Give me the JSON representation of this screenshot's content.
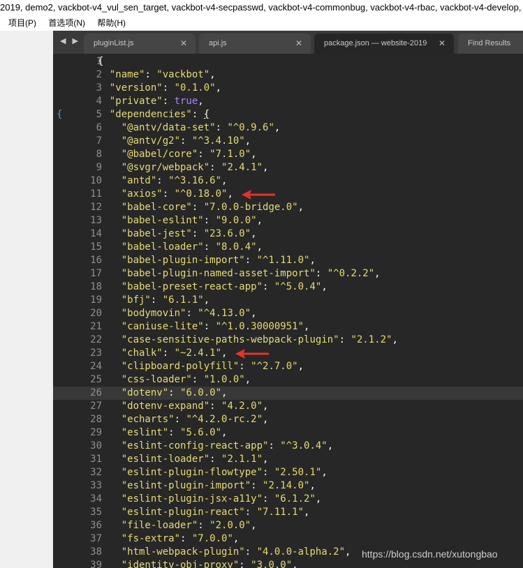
{
  "window": {
    "title": "2019, demo2, vackbot-v4_vul_sen_target, vackbot-v4-secpasswd, vackbot-v4-commonbug, vackbot-v4-rbac, vackbot-v4-develop,"
  },
  "menu": [
    "项目(P)",
    "首选项(N)",
    "帮助(H)"
  ],
  "tab_nav": "◀ ▶",
  "tabs": [
    {
      "label": "pluginList.js",
      "close": "✕"
    },
    {
      "label": "api.js",
      "close": "✕"
    },
    {
      "label": "package.json — website-2019",
      "close": "✕"
    },
    {
      "label": "Find Results",
      "close": ""
    }
  ],
  "highlight_line": 26,
  "fold_marker": "{",
  "code_lines": [
    {
      "n": "1",
      "p": [
        "{"
      ]
    },
    {
      "n": "2",
      "p": [
        "  ",
        "\"name\"",
        ": ",
        "\"vackbot\"",
        ","
      ]
    },
    {
      "n": "3",
      "p": [
        "  ",
        "\"version\"",
        ": ",
        "\"0.1.0\"",
        ","
      ]
    },
    {
      "n": "4",
      "p": [
        "  ",
        "\"private\"",
        ": ",
        "true",
        ","
      ]
    },
    {
      "n": "5",
      "p": [
        "  ",
        "\"dependencies\"",
        ": ",
        "{",
        ""
      ]
    },
    {
      "n": "6",
      "p": [
        "    ",
        "\"@antv/data-set\"",
        ": ",
        "\"^0.9.6\"",
        ","
      ]
    },
    {
      "n": "7",
      "p": [
        "    ",
        "\"@antv/g2\"",
        ": ",
        "\"^3.4.10\"",
        ","
      ]
    },
    {
      "n": "8",
      "p": [
        "    ",
        "\"@babel/core\"",
        ": ",
        "\"7.1.0\"",
        ","
      ]
    },
    {
      "n": "9",
      "p": [
        "    ",
        "\"@svgr/webpack\"",
        ": ",
        "\"2.4.1\"",
        ","
      ]
    },
    {
      "n": "10",
      "p": [
        "    ",
        "\"antd\"",
        ": ",
        "\"^3.16.6\"",
        ","
      ]
    },
    {
      "n": "11",
      "p": [
        "    ",
        "\"axios\"",
        ": ",
        "\"^0.18.0\"",
        ","
      ]
    },
    {
      "n": "12",
      "p": [
        "    ",
        "\"babel-core\"",
        ": ",
        "\"7.0.0-bridge.0\"",
        ","
      ]
    },
    {
      "n": "13",
      "p": [
        "    ",
        "\"babel-eslint\"",
        ": ",
        "\"9.0.0\"",
        ","
      ]
    },
    {
      "n": "14",
      "p": [
        "    ",
        "\"babel-jest\"",
        ": ",
        "\"23.6.0\"",
        ","
      ]
    },
    {
      "n": "15",
      "p": [
        "    ",
        "\"babel-loader\"",
        ": ",
        "\"8.0.4\"",
        ","
      ]
    },
    {
      "n": "16",
      "p": [
        "    ",
        "\"babel-plugin-import\"",
        ": ",
        "\"^1.11.0\"",
        ","
      ]
    },
    {
      "n": "17",
      "p": [
        "    ",
        "\"babel-plugin-named-asset-import\"",
        ": ",
        "\"^0.2.2\"",
        ","
      ]
    },
    {
      "n": "18",
      "p": [
        "    ",
        "\"babel-preset-react-app\"",
        ": ",
        "\"^5.0.4\"",
        ","
      ]
    },
    {
      "n": "19",
      "p": [
        "    ",
        "\"bfj\"",
        ": ",
        "\"6.1.1\"",
        ","
      ]
    },
    {
      "n": "20",
      "p": [
        "    ",
        "\"bodymovin\"",
        ": ",
        "\"^4.13.0\"",
        ","
      ]
    },
    {
      "n": "21",
      "p": [
        "    ",
        "\"caniuse-lite\"",
        ": ",
        "\"^1.0.30000951\"",
        ","
      ]
    },
    {
      "n": "22",
      "p": [
        "    ",
        "\"case-sensitive-paths-webpack-plugin\"",
        ": ",
        "\"2.1.2\"",
        ","
      ]
    },
    {
      "n": "23",
      "p": [
        "    ",
        "\"chalk\"",
        ": ",
        "\"~2.4.1\"",
        ","
      ]
    },
    {
      "n": "24",
      "p": [
        "    ",
        "\"clipboard-polyfill\"",
        ": ",
        "\"^2.7.0\"",
        ","
      ]
    },
    {
      "n": "25",
      "p": [
        "    ",
        "\"css-loader\"",
        ": ",
        "\"1.0.0\"",
        ","
      ]
    },
    {
      "n": "26",
      "p": [
        "    ",
        "\"dotenv\"",
        ": ",
        "\"6.0.0\"",
        ","
      ]
    },
    {
      "n": "27",
      "p": [
        "    ",
        "\"dotenv-expand\"",
        ": ",
        "\"4.2.0\"",
        ","
      ]
    },
    {
      "n": "28",
      "p": [
        "    ",
        "\"echarts\"",
        ": ",
        "\"^4.2.0-rc.2\"",
        ","
      ]
    },
    {
      "n": "29",
      "p": [
        "    ",
        "\"eslint\"",
        ": ",
        "\"5.6.0\"",
        ","
      ]
    },
    {
      "n": "30",
      "p": [
        "    ",
        "\"eslint-config-react-app\"",
        ": ",
        "\"^3.0.4\"",
        ","
      ]
    },
    {
      "n": "31",
      "p": [
        "    ",
        "\"eslint-loader\"",
        ": ",
        "\"2.1.1\"",
        ","
      ]
    },
    {
      "n": "32",
      "p": [
        "    ",
        "\"eslint-plugin-flowtype\"",
        ": ",
        "\"2.50.1\"",
        ","
      ]
    },
    {
      "n": "33",
      "p": [
        "    ",
        "\"eslint-plugin-import\"",
        ": ",
        "\"2.14.0\"",
        ","
      ]
    },
    {
      "n": "34",
      "p": [
        "    ",
        "\"eslint-plugin-jsx-a11y\"",
        ": ",
        "\"6.1.2\"",
        ","
      ]
    },
    {
      "n": "35",
      "p": [
        "    ",
        "\"eslint-plugin-react\"",
        ": ",
        "\"7.11.1\"",
        ","
      ]
    },
    {
      "n": "36",
      "p": [
        "    ",
        "\"file-loader\"",
        ": ",
        "\"2.0.0\"",
        ","
      ]
    },
    {
      "n": "37",
      "p": [
        "    ",
        "\"fs-extra\"",
        ": ",
        "\"7.0.0\"",
        ","
      ]
    },
    {
      "n": "38",
      "p": [
        "    ",
        "\"html-webpack-plugin\"",
        ": ",
        "\"4.0.0-alpha.2\"",
        ","
      ]
    },
    {
      "n": "39",
      "p": [
        "    ",
        "\"identity-obj-proxy\"",
        ": ",
        "\"3.0.0\"",
        ","
      ]
    }
  ],
  "annotations": [
    {
      "icon": "red-arrow-icon",
      "color": "#e8322b",
      "line": 11
    },
    {
      "icon": "red-arrow-icon",
      "color": "#e8322b",
      "line": 23
    }
  ],
  "watermark": "https://blog.csdn.net/xutongbao"
}
